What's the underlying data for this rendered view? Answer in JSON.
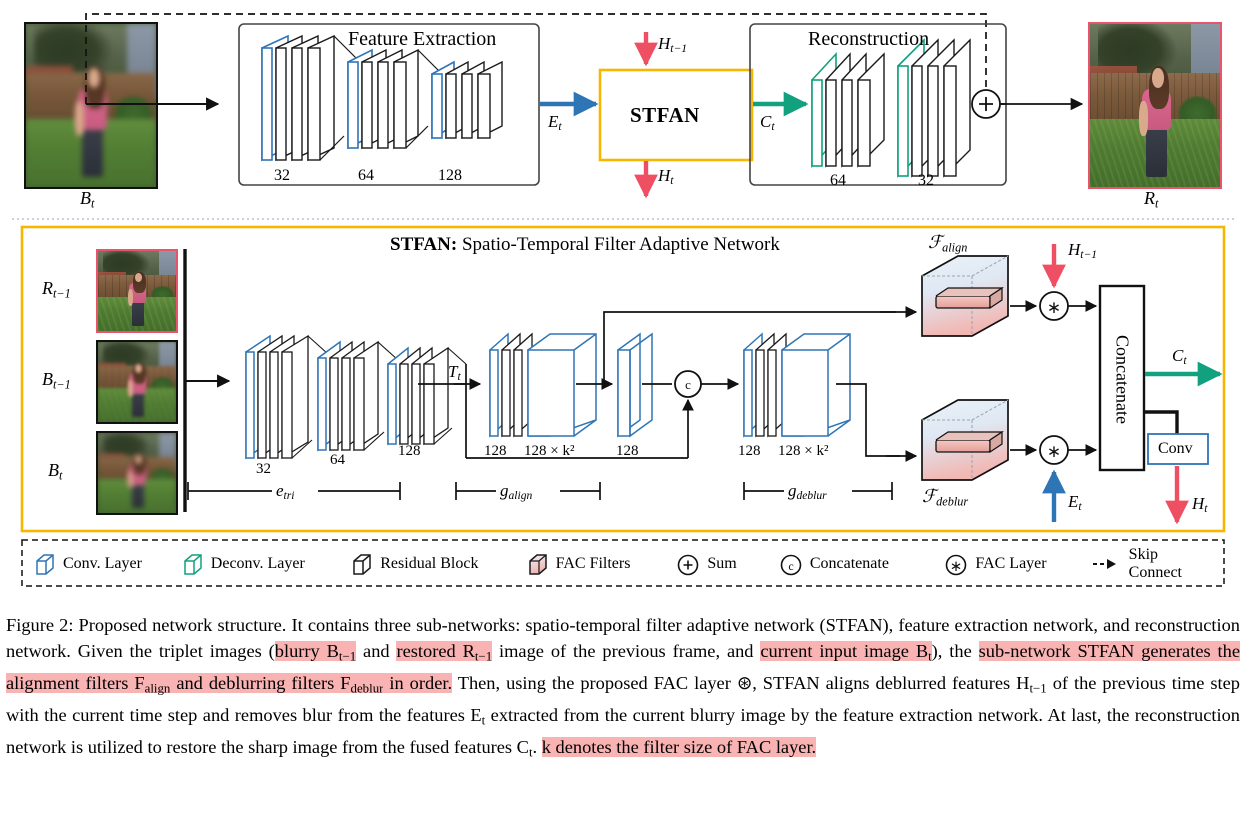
{
  "figure": {
    "caption_label": "Figure 2:",
    "caption_runs": [
      {
        "t": "Figure 2:  Proposed network structure.  It contains three sub-networks: spatio-temporal filter adaptive network (STFAN), feature extraction network, and reconstruction network.  Given the triplet images (",
        "hl": false
      },
      {
        "t": "blurry B",
        "hl": true,
        "sub": "t−1"
      },
      {
        "t": " and ",
        "hl": false
      },
      {
        "t": "restored R",
        "hl": true,
        "sub": "t−1"
      },
      {
        "t": " image of the previous frame, and ",
        "hl": false
      },
      {
        "t": "current input image B",
        "hl": true,
        "sub": "t"
      },
      {
        "t": "), the ",
        "hl": false
      },
      {
        "t": "sub-network STFAN generates the alignment filters F",
        "hl": true,
        "sub": "align"
      },
      {
        "t": " and ",
        "hl": true
      },
      {
        "t": "deblurring filters F",
        "hl": true,
        "sub": "deblur"
      },
      {
        "t": " in order.",
        "hl": true
      },
      {
        "t": "  Then, using the proposed FAC layer ⊛, STFAN aligns deblurred features H",
        "hl": false,
        "sub": "t−1"
      },
      {
        "t": " of the previous time step with the current time step and removes blur from the features E",
        "hl": false,
        "sub": "t"
      },
      {
        "t": " extracted from the current blurry image by the feature extraction network.  At last, the reconstruction network is utilized to restore the sharp image from the fused features C",
        "hl": false,
        "sub": "t"
      },
      {
        "t": ". ",
        "hl": false
      },
      {
        "t": "k denotes the filter size of FAC layer.",
        "hl": true
      }
    ],
    "caption_full": "Figure 2: Proposed network structure. It contains three sub-networks: spatio-temporal filter adaptive network (STFAN), feature extraction network, and reconstruction network. Given the triplet images (blurry B_{t-1} and restored R_{t-1} image of the previous frame, and current input image B_t), the sub-network STFAN generates the alignment filters F_align and deblurring filters F_deblur in order. Then, using the proposed FAC layer ⊛, STFAN aligns deblurred features H_{t-1} of the previous time step with the current time step and removes blur from the features E_t extracted from the current blurry image by the feature extraction network. At last, the reconstruction network is utilized to restore the sharp image from the fused features C_t. k denotes the filter size of FAC layer."
  },
  "top": {
    "input_label": "B",
    "input_sub": "t",
    "output_label": "R",
    "output_sub": "t",
    "feature_extraction_title": "Feature Extraction",
    "feature_extraction_channels": [
      "32",
      "64",
      "128"
    ],
    "reconstruction_title": "Reconstruction",
    "reconstruction_channels": [
      "64",
      "32"
    ],
    "stfan_box_label": "STFAN",
    "edge_Et": "E",
    "edge_Et_sub": "t",
    "edge_Ct": "C",
    "edge_Ct_sub": "t",
    "edge_Hprev": "H",
    "edge_Hprev_sub": "t−1",
    "edge_Ht": "H",
    "edge_Ht_sub": "t",
    "sum_symbol": "+"
  },
  "stfan": {
    "panel_title_bold": "STFAN:",
    "panel_title_rest": " Spatio-Temporal Filter Adaptive Network",
    "inputs": [
      {
        "label": "R",
        "sub": "t−1",
        "border": "#e8546b",
        "style": "sharp"
      },
      {
        "label": "B",
        "sub": "t−1",
        "border": "#111111",
        "style": "blurred-soft"
      },
      {
        "label": "B",
        "sub": "t",
        "border": "#111111",
        "style": "blurred"
      }
    ],
    "etri_channels": [
      "32",
      "64",
      "128"
    ],
    "Tt_label": "T",
    "Tt_sub": "t",
    "galign_channels": [
      "128",
      "128 × k²"
    ],
    "mid_channel": "128",
    "gdeblur_channels": [
      "128",
      "128 × k²"
    ],
    "concat_symbol": "c",
    "fac_symbol": "∗",
    "brackets": [
      {
        "label": "e",
        "sub": "tri"
      },
      {
        "label": "g",
        "sub": "align"
      },
      {
        "label": "g",
        "sub": "deblur"
      }
    ],
    "filter_align_label": "F",
    "filter_align_sub": "align",
    "filter_deblur_label": "F",
    "filter_deblur_sub": "deblur",
    "concatenate_label": "Concatenate",
    "conv_box_label": "Conv",
    "edge_Hprev": "H",
    "edge_Hprev_sub": "t−1",
    "edge_Et": "E",
    "edge_Et_sub": "t",
    "edge_Ct": "C",
    "edge_Ct_sub": "t",
    "edge_Ht": "H",
    "edge_Ht_sub": "t"
  },
  "legend": {
    "items": [
      {
        "icon": "cube-blue-icon",
        "label": "Conv. Layer"
      },
      {
        "icon": "cube-green-icon",
        "label": "Deconv. Layer"
      },
      {
        "icon": "cube-black-icon",
        "label": "Residual Block"
      },
      {
        "icon": "cube-gradient-icon",
        "label": "FAC Filters"
      },
      {
        "icon": "circle-plus-icon",
        "label": "Sum"
      },
      {
        "icon": "circle-c-icon",
        "label": "Concatenate"
      },
      {
        "icon": "circle-asterisk-icon",
        "label": "FAC Layer"
      },
      {
        "icon": "dashed-arrow-icon",
        "label": "Skip Connect"
      }
    ]
  },
  "colors": {
    "conv_blue": "#2e75b6",
    "deconv_green": "#12a17f",
    "residual_black": "#1a1a1a",
    "stfan_gold": "#f5b700",
    "arrow_red": "#ef4f63",
    "arrow_blue": "#2e75b6",
    "arrow_green": "#12a17f",
    "highlight_pink": "#f9b3b3",
    "photo_border_red": "#e8546b"
  }
}
